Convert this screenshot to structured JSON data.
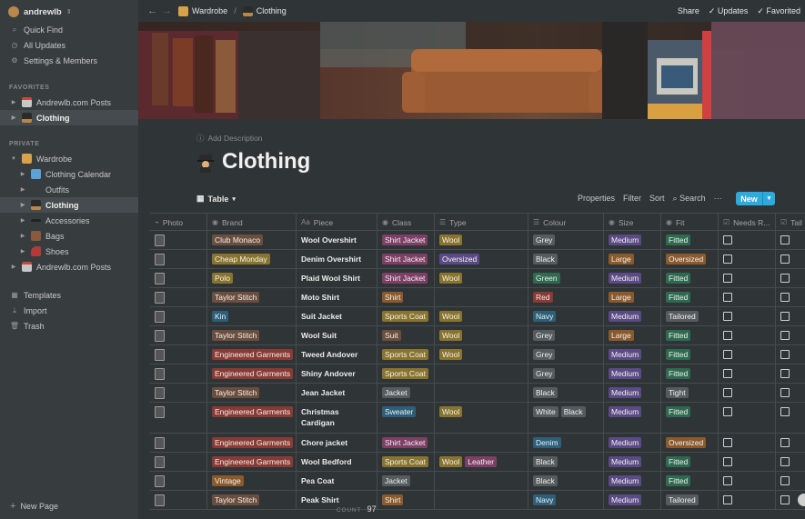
{
  "sidebar": {
    "workspace": "andrewlb",
    "quick_find": "Quick Find",
    "all_updates": "All Updates",
    "settings": "Settings & Members",
    "favorites_label": "FAVORITES",
    "favorites": [
      {
        "label": "Andrewlb.com Posts",
        "icon": "calendar-icon",
        "active": false
      },
      {
        "label": "Clothing",
        "icon": "detective-icon",
        "active": true
      }
    ],
    "private_label": "PRIVATE",
    "private": [
      {
        "label": "Wardrobe",
        "icon": "hanger-icon",
        "depth": 0,
        "open": true
      },
      {
        "label": "Clothing Calendar",
        "icon": "calendar-icon",
        "depth": 1
      },
      {
        "label": "Outfits",
        "icon": "",
        "depth": 1
      },
      {
        "label": "Clothing",
        "icon": "detective-icon",
        "depth": 1,
        "active": true
      },
      {
        "label": "Accessories",
        "icon": "sunglasses-icon",
        "depth": 1
      },
      {
        "label": "Bags",
        "icon": "briefcase-icon",
        "depth": 1
      },
      {
        "label": "Shoes",
        "icon": "shoe-icon",
        "depth": 1
      },
      {
        "label": "Andrewlb.com Posts",
        "icon": "calendar-icon",
        "depth": 0
      }
    ],
    "templates": "Templates",
    "import": "Import",
    "trash": "Trash",
    "new_page": "New Page"
  },
  "topbar": {
    "crumb_parent": "Wardrobe",
    "crumb_current": "Clothing",
    "share": "Share",
    "updates": "Updates",
    "favorited": "Favorited"
  },
  "page": {
    "add_description": "Add Description",
    "title": "Clothing"
  },
  "toolbar": {
    "view": "Table",
    "properties": "Properties",
    "filter": "Filter",
    "sort": "Sort",
    "search": "Search",
    "more": "···",
    "new": "New"
  },
  "columns": [
    {
      "key": "photo",
      "label": "Photo",
      "icon": "paperclip-icon"
    },
    {
      "key": "brand",
      "label": "Brand",
      "icon": "select-icon"
    },
    {
      "key": "piece",
      "label": "Piece",
      "icon": "text-icon"
    },
    {
      "key": "class",
      "label": "Class",
      "icon": "select-icon"
    },
    {
      "key": "type",
      "label": "Type",
      "icon": "list-icon"
    },
    {
      "key": "colour",
      "label": "Colour",
      "icon": "list-icon"
    },
    {
      "key": "size",
      "label": "Size",
      "icon": "select-icon"
    },
    {
      "key": "fit",
      "label": "Fit",
      "icon": "select-icon"
    },
    {
      "key": "needs",
      "label": "Needs R...",
      "icon": "checkbox-icon"
    },
    {
      "key": "tail",
      "label": "Tail",
      "icon": "checkbox-icon"
    }
  ],
  "colors": {
    "brown": "#6b4e3d",
    "orange": "#8a5a2c",
    "yellow": "#89742e",
    "green": "#2e6a4f",
    "blue": "#2d5f7a",
    "purple": "#5b4a85",
    "pink": "#7d3f66",
    "red": "#8a3a34",
    "gray": "#555b5e",
    "accent": "#2eaadc"
  },
  "rows": [
    {
      "brand": [
        "Club Monaco",
        "brown"
      ],
      "piece": "Wool Overshirt",
      "class": [
        [
          "Shirt Jacket",
          "pink"
        ]
      ],
      "type": [
        [
          "Wool",
          "yellow"
        ]
      ],
      "colour": [
        [
          "Grey",
          "gray"
        ]
      ],
      "size": [
        "Medium",
        "purple"
      ],
      "fit": [
        "Fitted",
        "green"
      ]
    },
    {
      "brand": [
        "Cheap Monday",
        "yellow"
      ],
      "piece": "Denim Overshirt",
      "class": [
        [
          "Shirt Jacket",
          "pink"
        ]
      ],
      "type": [
        [
          "Oversized",
          "purple"
        ]
      ],
      "colour": [
        [
          "Black",
          "gray"
        ]
      ],
      "size": [
        "Large",
        "orange"
      ],
      "fit": [
        "Oversized",
        "orange"
      ]
    },
    {
      "brand": [
        "Polo",
        "yellow"
      ],
      "piece": "Plaid Wool Shirt",
      "class": [
        [
          "Shirt Jacket",
          "pink"
        ]
      ],
      "type": [
        [
          "Wool",
          "yellow"
        ]
      ],
      "colour": [
        [
          "Green",
          "green"
        ]
      ],
      "size": [
        "Medium",
        "purple"
      ],
      "fit": [
        "Fitted",
        "green"
      ]
    },
    {
      "brand": [
        "Taylor Stitch",
        "brown"
      ],
      "piece": "Moto Shirt",
      "class": [
        [
          "Shirt",
          "orange"
        ]
      ],
      "type": [],
      "colour": [
        [
          "Red",
          "red"
        ]
      ],
      "size": [
        "Large",
        "orange"
      ],
      "fit": [
        "Fitted",
        "green"
      ]
    },
    {
      "brand": [
        "Kin",
        "blue"
      ],
      "piece": "Suit Jacket",
      "class": [
        [
          "Sports Coat",
          "yellow"
        ]
      ],
      "type": [
        [
          "Wool",
          "yellow"
        ]
      ],
      "colour": [
        [
          "Navy",
          "blue"
        ]
      ],
      "size": [
        "Medium",
        "purple"
      ],
      "fit": [
        "Tailored",
        "gray"
      ]
    },
    {
      "brand": [
        "Taylor Stitch",
        "brown"
      ],
      "piece": "Wool Suit",
      "class": [
        [
          "Suit",
          "brown"
        ]
      ],
      "type": [
        [
          "Wool",
          "yellow"
        ]
      ],
      "colour": [
        [
          "Grey",
          "gray"
        ]
      ],
      "size": [
        "Large",
        "orange"
      ],
      "fit": [
        "Fitted",
        "green"
      ]
    },
    {
      "brand": [
        "Engineered Garments",
        "red"
      ],
      "piece": "Tweed Andover",
      "class": [
        [
          "Sports Coat",
          "yellow"
        ]
      ],
      "type": [
        [
          "Wool",
          "yellow"
        ]
      ],
      "colour": [
        [
          "Grey",
          "gray"
        ]
      ],
      "size": [
        "Medium",
        "purple"
      ],
      "fit": [
        "Fitted",
        "green"
      ]
    },
    {
      "brand": [
        "Engineered Garments",
        "red"
      ],
      "piece": "Shiny Andover",
      "class": [
        [
          "Sports Coat",
          "yellow"
        ]
      ],
      "type": [],
      "colour": [
        [
          "Grey",
          "gray"
        ]
      ],
      "size": [
        "Medium",
        "purple"
      ],
      "fit": [
        "Fitted",
        "green"
      ]
    },
    {
      "brand": [
        "Taylor Stitch",
        "brown"
      ],
      "piece": "Jean Jacket",
      "class": [
        [
          "Jacket",
          "gray"
        ]
      ],
      "type": [],
      "colour": [
        [
          "Black",
          "gray"
        ]
      ],
      "size": [
        "Medium",
        "purple"
      ],
      "fit": [
        "Tight",
        "gray"
      ]
    },
    {
      "brand": [
        "Engineered Garments",
        "red"
      ],
      "piece": "Christmas Cardigan",
      "class": [
        [
          "Sweater",
          "blue"
        ]
      ],
      "type": [
        [
          "Wool",
          "yellow"
        ]
      ],
      "colour": [
        [
          "White",
          "gray"
        ],
        [
          "Black",
          "gray"
        ]
      ],
      "size": [
        "Medium",
        "purple"
      ],
      "fit": [
        "Fitted",
        "green"
      ],
      "tall": true
    },
    {
      "brand": [
        "Engineered Garments",
        "red"
      ],
      "piece": "Chore jacket",
      "class": [
        [
          "Shirt Jacket",
          "pink"
        ]
      ],
      "type": [],
      "colour": [
        [
          "Denim",
          "blue"
        ]
      ],
      "size": [
        "Medium",
        "purple"
      ],
      "fit": [
        "Oversized",
        "orange"
      ]
    },
    {
      "brand": [
        "Engineered Garments",
        "red"
      ],
      "piece": "Wool Bedford",
      "class": [
        [
          "Sports Coat",
          "yellow"
        ]
      ],
      "type": [
        [
          "Wool",
          "yellow"
        ],
        [
          "Leather",
          "pink"
        ]
      ],
      "colour": [
        [
          "Black",
          "gray"
        ]
      ],
      "size": [
        "Medium",
        "purple"
      ],
      "fit": [
        "Fitted",
        "green"
      ]
    },
    {
      "brand": [
        "Vintage",
        "orange"
      ],
      "piece": "Pea Coat",
      "class": [
        [
          "Jacket",
          "gray"
        ]
      ],
      "type": [],
      "colour": [
        [
          "Black",
          "gray"
        ]
      ],
      "size": [
        "Medium",
        "purple"
      ],
      "fit": [
        "Fitted",
        "green"
      ]
    },
    {
      "brand": [
        "Taylor Stitch",
        "brown"
      ],
      "piece": "Peak Shirt",
      "class": [
        [
          "Shirt",
          "orange"
        ]
      ],
      "type": [],
      "colour": [
        [
          "Navy",
          "blue"
        ]
      ],
      "size": [
        "Medium",
        "purple"
      ],
      "fit": [
        "Tailored",
        "gray"
      ]
    }
  ],
  "footer": {
    "count_label": "COUNT",
    "count": "97"
  }
}
